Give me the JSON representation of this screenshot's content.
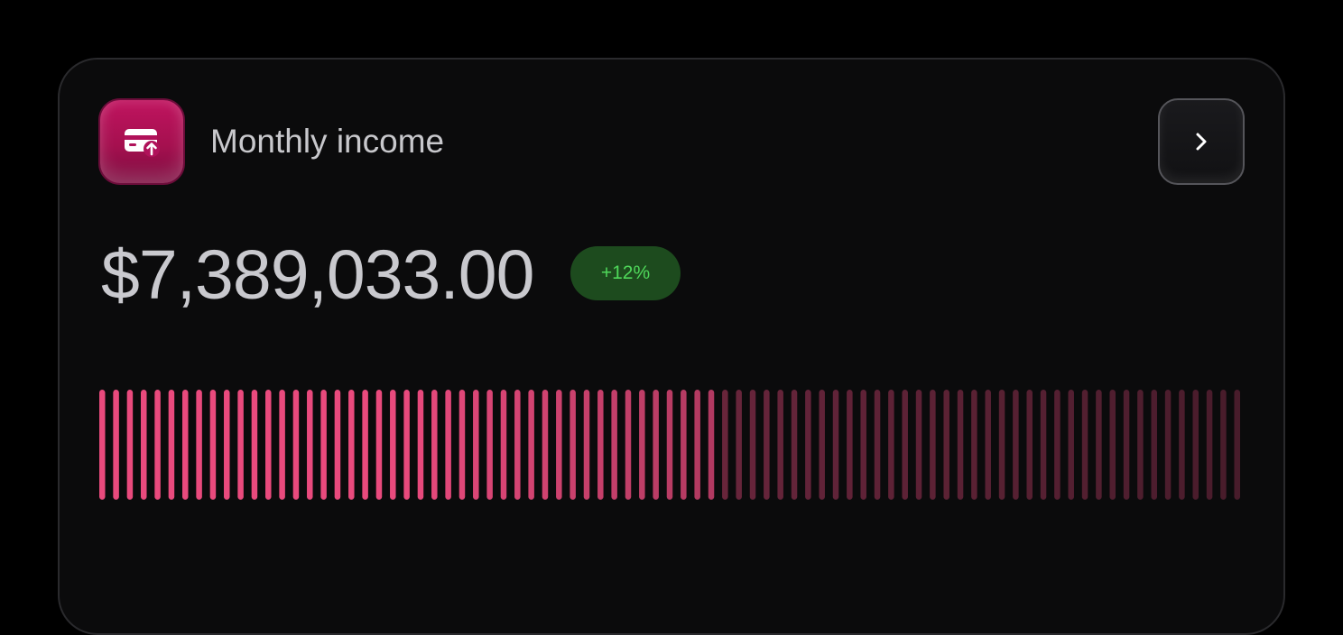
{
  "card": {
    "title": "Monthly income",
    "icon": "card-upload-icon",
    "amount": "$7,389,033.00",
    "change": "+12%",
    "nav_icon": "chevron-right-icon"
  },
  "colors": {
    "accent": "#e94a7d",
    "icon_bg": "#b0125a",
    "badge_bg": "#1d4b1e",
    "badge_text": "#4fd75a",
    "card_bg": "#0b0b0c"
  },
  "progress": {
    "bar_count": 83,
    "fill_fraction": 0.54
  }
}
